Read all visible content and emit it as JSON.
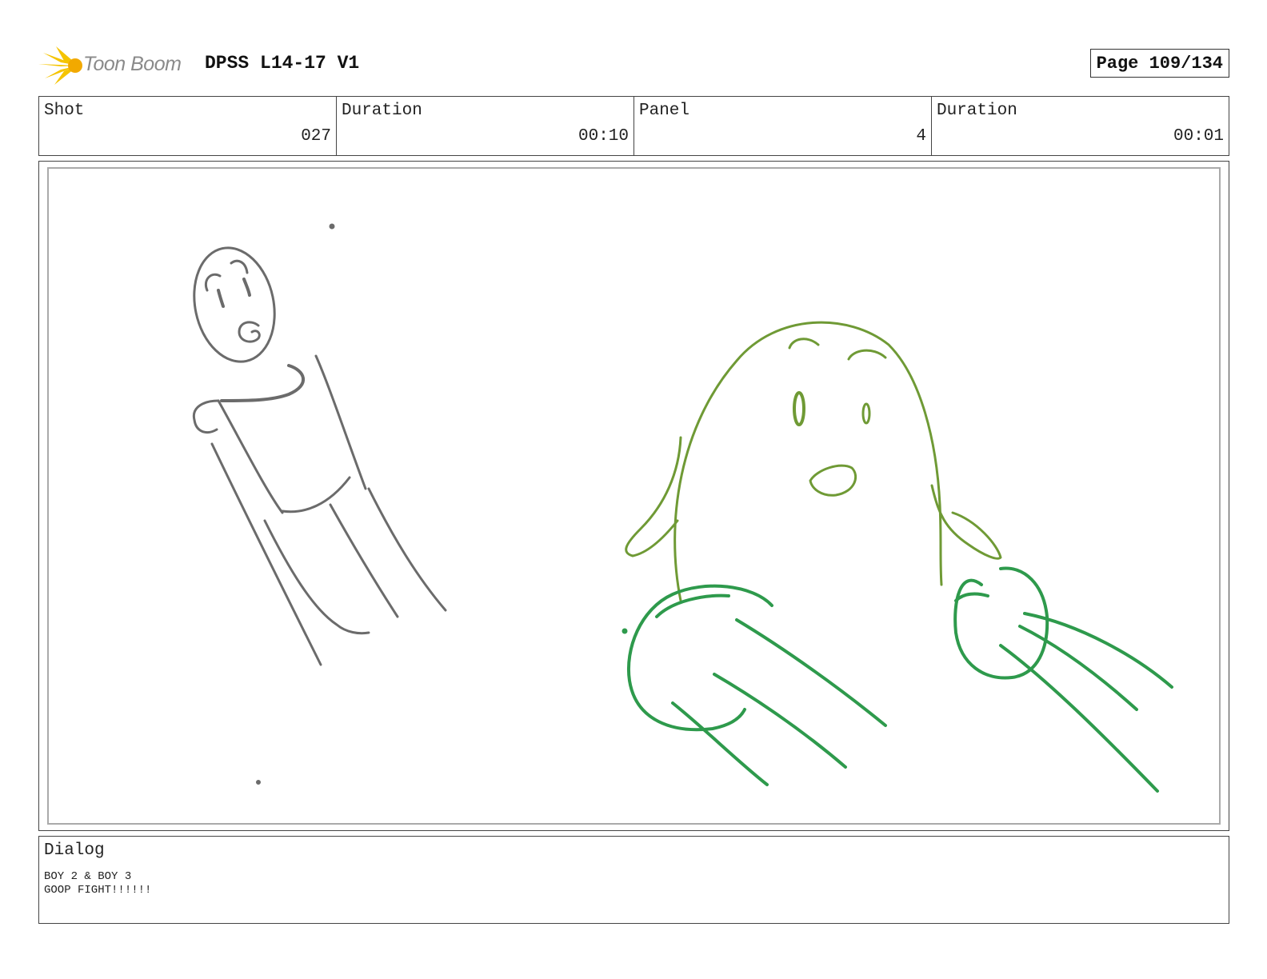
{
  "header": {
    "logo_text": "Toon Boom",
    "title": "DPSS L14-17 V1",
    "page": "Page 109/134"
  },
  "info": {
    "shot_label": "Shot",
    "shot_value": "027",
    "duration_label": "Duration",
    "duration_value": "00:10",
    "panel_label": "Panel",
    "panel_value": "4",
    "panel_duration_label": "Duration",
    "panel_duration_value": "00:01"
  },
  "panel_image": {
    "left_figure_color": "#6b6b6b",
    "right_figure_color": "#6f9a35",
    "hands_color": "#2e9a4c"
  },
  "dialog": {
    "label": "Dialog",
    "line1": "BOY 2 & BOY 3",
    "line2": "GOOP FIGHT!!!!!!"
  }
}
